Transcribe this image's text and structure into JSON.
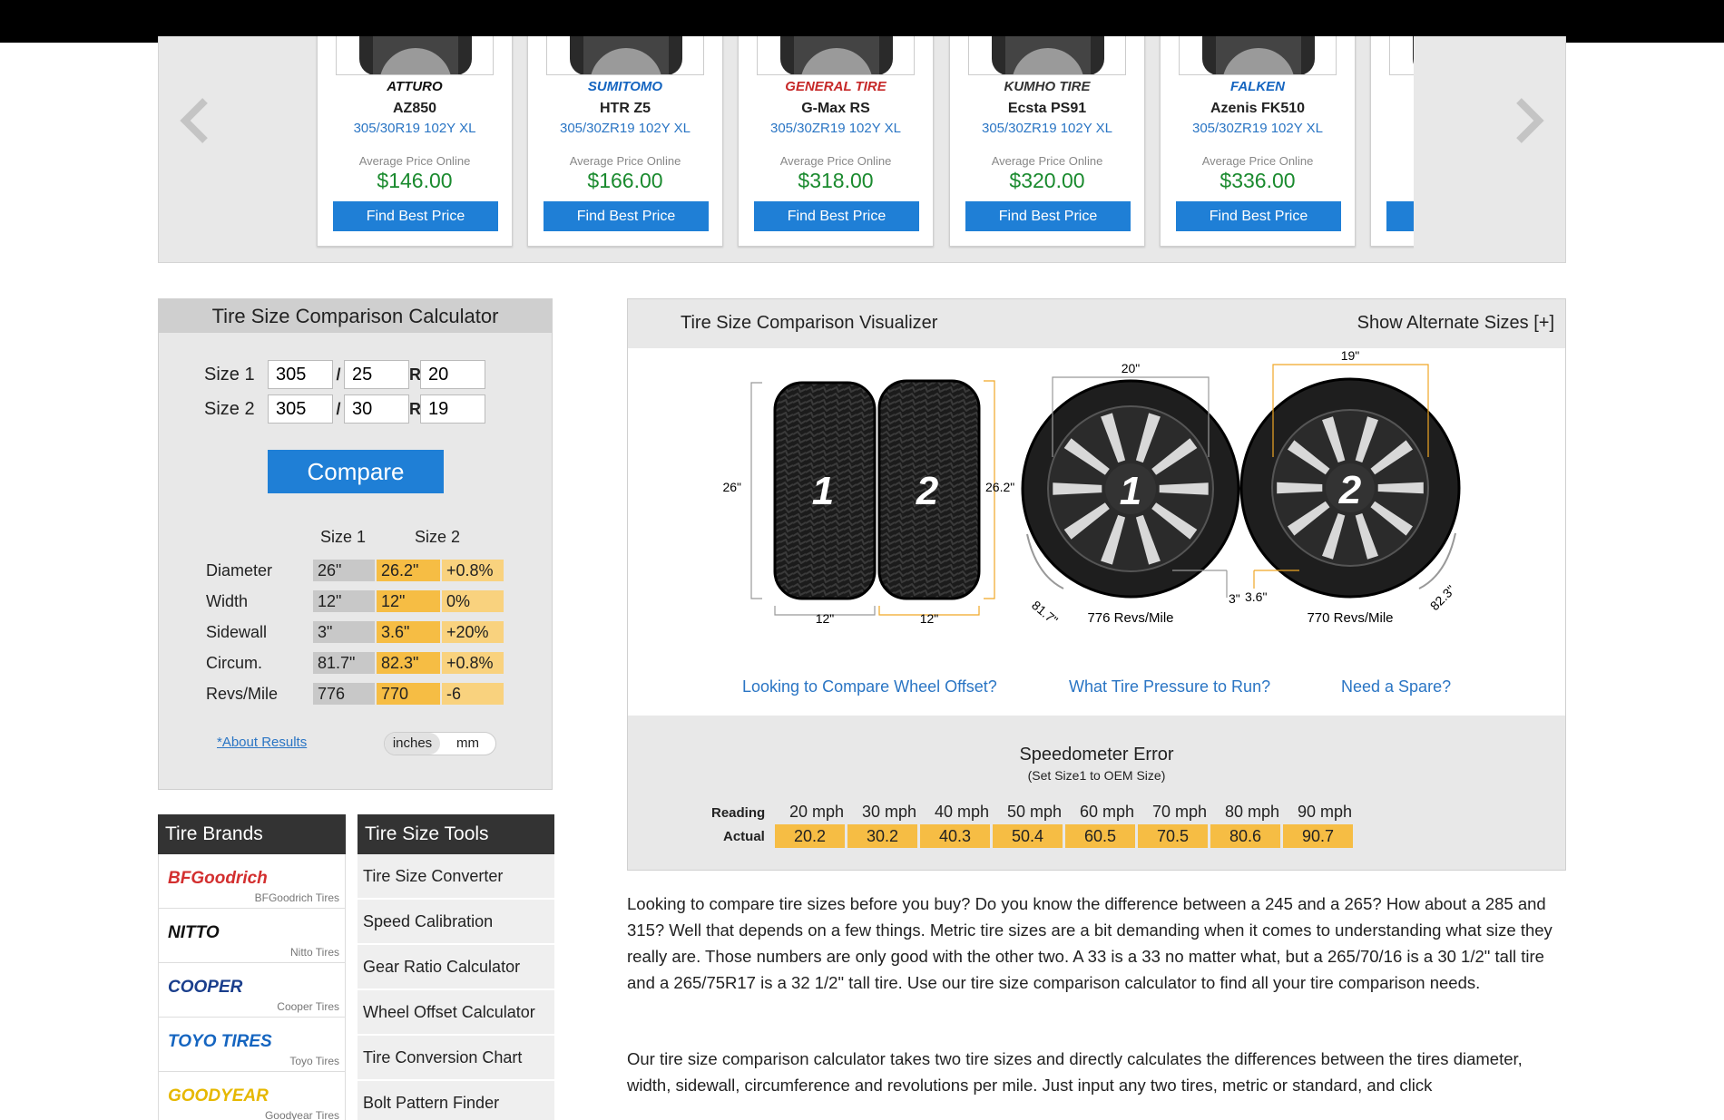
{
  "carousel": {
    "cards": [
      {
        "brand": "ATTURO",
        "brand_color": "#111111",
        "model": "AZ850",
        "size": "305/30R19 102Y XL",
        "avg_label": "Average Price Online",
        "price": "$146.00",
        "button": "Find Best Price"
      },
      {
        "brand": "SUMITOMO",
        "brand_color": "#1565c0",
        "model": "HTR Z5",
        "size": "305/30ZR19 102Y XL",
        "avg_label": "Average Price Online",
        "price": "$166.00",
        "button": "Find Best Price"
      },
      {
        "brand": "GENERAL TIRE",
        "brand_color": "#c62828",
        "model": "G-Max RS",
        "size": "305/30ZR19 102Y XL",
        "avg_label": "Average Price Online",
        "price": "$318.00",
        "button": "Find Best Price"
      },
      {
        "brand": "KUMHO TIRE",
        "brand_color": "#333333",
        "model": "Ecsta PS91",
        "size": "305/30ZR19 102Y XL",
        "avg_label": "Average Price Online",
        "price": "$320.00",
        "button": "Find Best Price"
      },
      {
        "brand": "FALKEN",
        "brand_color": "#1565c0",
        "model": "Azenis FK510",
        "size": "305/30ZR19 102Y XL",
        "avg_label": "Average Price Online",
        "price": "$336.00",
        "button": "Find Best Price"
      },
      {
        "brand": "",
        "brand_color": "#111111",
        "model": "",
        "size": "30",
        "avg_label": "A",
        "price": "",
        "button": ""
      }
    ]
  },
  "calculator": {
    "title": "Tire Size Comparison Calculator",
    "size1": {
      "label": "Size 1",
      "width": "305",
      "aspect": "25",
      "rim": "20"
    },
    "size2": {
      "label": "Size 2",
      "width": "305",
      "aspect": "30",
      "rim": "19"
    },
    "slash": "/",
    "r": "R",
    "compare_button": "Compare",
    "col1": "Size 1",
    "col2": "Size 2",
    "rows": [
      {
        "label": "Diameter",
        "s1": "26\"",
        "s2": "26.2\"",
        "diff": "+0.8%"
      },
      {
        "label": "Width",
        "s1": "12\"",
        "s2": "12\"",
        "diff": "0%"
      },
      {
        "label": "Sidewall",
        "s1": "3\"",
        "s2": "3.6\"",
        "diff": "+20%"
      },
      {
        "label": "Circum.",
        "s1": "81.7\"",
        "s2": "82.3\"",
        "diff": "+0.8%"
      },
      {
        "label": "Revs/Mile",
        "s1": "776",
        "s2": "770",
        "diff": "-6"
      }
    ],
    "about_link": "*About Results",
    "unit_inches": "inches",
    "unit_mm": "mm"
  },
  "brands": {
    "title": "Tire Brands",
    "items": [
      {
        "logo": "BFGoodrich",
        "caption": "BFGoodrich Tires",
        "color": "#d32f2f"
      },
      {
        "logo": "NITTO",
        "caption": "Nitto Tires",
        "color": "#111111"
      },
      {
        "logo": "COOPER",
        "caption": "Cooper Tires",
        "color": "#1a3e8c"
      },
      {
        "logo": "TOYO TIRES",
        "caption": "Toyo Tires",
        "color": "#1565c0"
      },
      {
        "logo": "GOODYEAR",
        "caption": "Goodyear Tires",
        "color": "#e6b800"
      }
    ]
  },
  "tools": {
    "title": "Tire Size Tools",
    "items": [
      "Tire Size Converter",
      "Speed Calibration",
      "Gear Ratio Calculator",
      "Wheel Offset Calculator",
      "Tire Conversion Chart",
      "Bolt Pattern Finder"
    ]
  },
  "visualizer": {
    "title": "Tire Size Comparison Visualizer",
    "alt_sizes": "Show Alternate Sizes [+]",
    "tire1_label": "1",
    "tire2_label": "2",
    "side_diam1": "26\"",
    "side_diam2": "26.2\"",
    "tread_w1": "12\"",
    "tread_w2": "12\"",
    "rim1": "20\"",
    "rim2": "19\"",
    "circ1": "81.7\"",
    "circ2": "82.3\"",
    "sidewall1": "3\"",
    "sidewall2": "3.6\"",
    "revs1": "776 Revs/Mile",
    "revs2": "770 Revs/Mile",
    "links": [
      "Looking to Compare Wheel Offset?",
      "What Tire Pressure to Run?",
      "Need a Spare?"
    ],
    "accent": "#f0a726"
  },
  "speedometer": {
    "title": "Speedometer Error",
    "subtitle": "(Set Size1 to OEM Size)",
    "reading_label": "Reading",
    "actual_label": "Actual",
    "readings": [
      "20 mph",
      "30 mph",
      "40 mph",
      "50 mph",
      "60 mph",
      "70 mph",
      "80 mph",
      "90 mph"
    ],
    "actuals": [
      "20.2",
      "30.2",
      "40.3",
      "50.4",
      "60.5",
      "70.5",
      "80.6",
      "90.7"
    ]
  },
  "article": {
    "p1": "Looking to compare tire sizes before you buy? Do you know the difference between a 245 and a 265? How about a 285 and 315? Well that depends on a few things. Metric tire sizes are a bit demanding when it comes to understanding what size they really are. Those numbers are only good with the other two. A 33 is a 33 no matter what, but a 265/70/16 is a 30 1/2\" tall tire and a 265/75R17 is a 32 1/2\" tall tire. Use our tire size comparison calculator to find all your tire comparison needs.",
    "p2": "Our tire size comparison calculator takes two tire sizes and directly calculates the differences between the tires diameter, width, sidewall, circumference and revolutions per mile. Just input any two tires, metric or standard, and click"
  }
}
